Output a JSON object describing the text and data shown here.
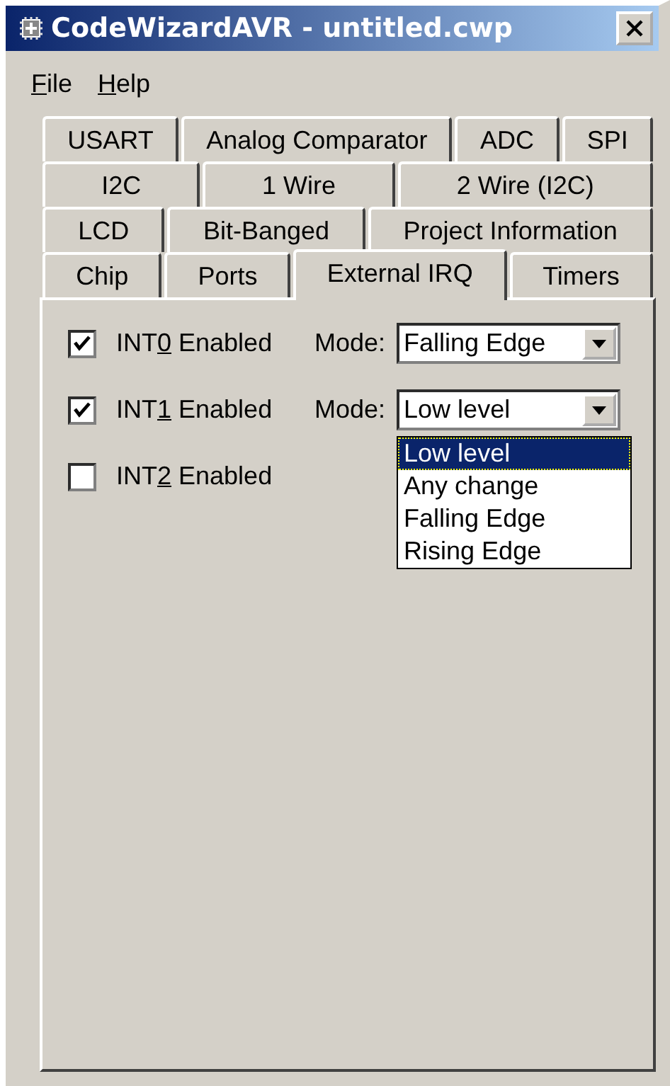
{
  "window": {
    "title": "CodeWizardAVR - untitled.cwp"
  },
  "menu": [
    {
      "key": "F",
      "post": "ile"
    },
    {
      "key": "H",
      "post": "elp"
    }
  ],
  "tab_rows": [
    [
      {
        "label": "USART",
        "selected": false
      },
      {
        "label": "Analog Comparator",
        "selected": false
      },
      {
        "label": "ADC",
        "selected": false
      },
      {
        "label": "SPI",
        "selected": false
      }
    ],
    [
      {
        "label": "I2C",
        "selected": false
      },
      {
        "label": "1 Wire",
        "selected": false
      },
      {
        "label": "2 Wire (I2C)",
        "selected": false
      }
    ],
    [
      {
        "label": "LCD",
        "selected": false
      },
      {
        "label": "Bit-Banged",
        "selected": false
      },
      {
        "label": "Project Information",
        "selected": false
      }
    ],
    [
      {
        "label": "Chip",
        "selected": false
      },
      {
        "label": "Ports",
        "selected": false
      },
      {
        "label": "External IRQ",
        "selected": true
      },
      {
        "label": "Timers",
        "selected": false
      }
    ]
  ],
  "interrupts": [
    {
      "pre": "INT",
      "key": "0",
      "post": " Enabled",
      "checked": true,
      "mode_label": "Mode:",
      "mode_value": "Falling Edge"
    },
    {
      "pre": "INT",
      "key": "1",
      "post": " Enabled",
      "checked": true,
      "mode_label": "Mode:",
      "mode_value": "Low level",
      "expanded": true,
      "options": [
        {
          "label": "Low level",
          "selected": true
        },
        {
          "label": "Any change",
          "selected": false
        },
        {
          "label": "Falling Edge",
          "selected": false
        },
        {
          "label": "Rising Edge",
          "selected": false
        }
      ]
    },
    {
      "pre": "INT",
      "key": "2",
      "post": " Enabled",
      "checked": false
    }
  ]
}
